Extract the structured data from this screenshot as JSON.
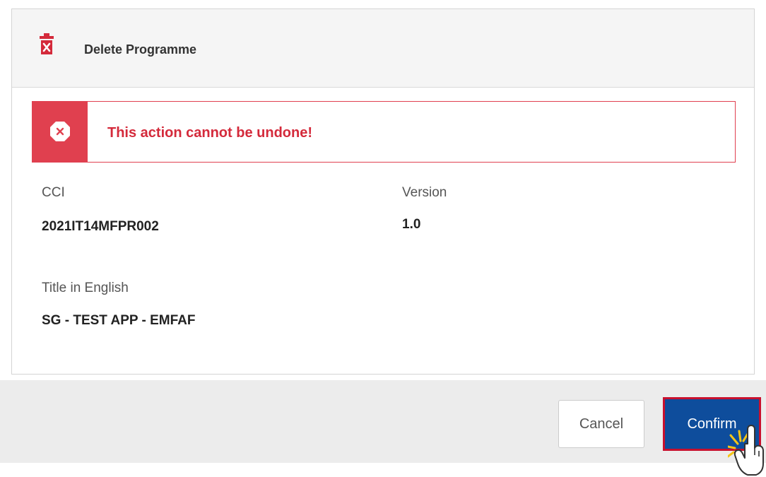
{
  "dialog": {
    "title": "Delete Programme",
    "header_icon": "trash-delete-icon",
    "accent_color": "#d42a3b"
  },
  "alert": {
    "icon": "error-x-icon",
    "message": "This action cannot be undone!"
  },
  "fields": {
    "cci": {
      "label": "CCI",
      "value": "2021IT14MFPR002"
    },
    "version": {
      "label": "Version",
      "value": "1.0"
    },
    "title_english": {
      "label": "Title in English",
      "value": "SG - TEST APP - EMFAF"
    }
  },
  "footer": {
    "cancel_label": "Cancel",
    "confirm_label": "Confirm",
    "confirm_color": "#0e4d9c"
  },
  "cursor": {
    "icon": "hand-pointer-click-icon"
  }
}
